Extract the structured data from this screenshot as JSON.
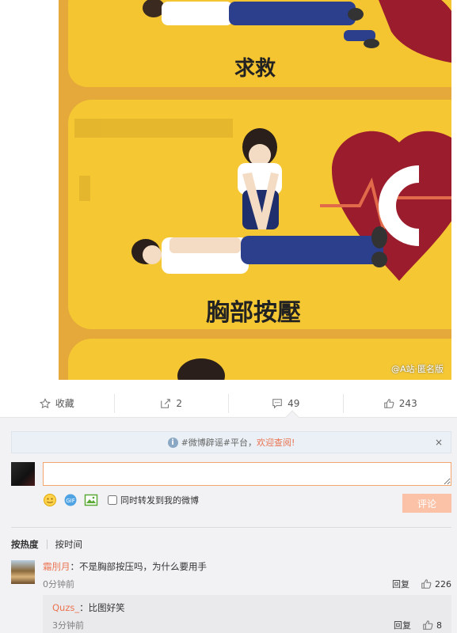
{
  "post": {
    "watermark": "@A站·匿名版",
    "image_texts": [
      "求救",
      "胸部按壓"
    ]
  },
  "actions": {
    "favorite_label": "收藏",
    "repost_count": "2",
    "comment_count": "49",
    "like_count": "243"
  },
  "notice": {
    "prefix": "#微博辟谣#平台，",
    "link": "欢迎查阅!",
    "close": "×"
  },
  "composer": {
    "input_value": "",
    "repost_label": "同时转发到我的微博",
    "submit_label": "评论"
  },
  "sort": {
    "by_heat": "按热度",
    "by_time": "按时间"
  },
  "comments": [
    {
      "user": "霜刖月",
      "text": "：不是胸部按压吗，为什么要用手",
      "time": "0分钟前",
      "reply_label": "回复",
      "likes": "226"
    }
  ],
  "replies": [
    {
      "user": "Quzs_",
      "text": "：比图好笑",
      "time": "3分钟前",
      "reply_label": "回复",
      "likes": "8"
    }
  ],
  "colors": {
    "accent": "#eb7350",
    "poster_yellow": "#f0b92c",
    "heart_red": "#9b1c2c"
  }
}
